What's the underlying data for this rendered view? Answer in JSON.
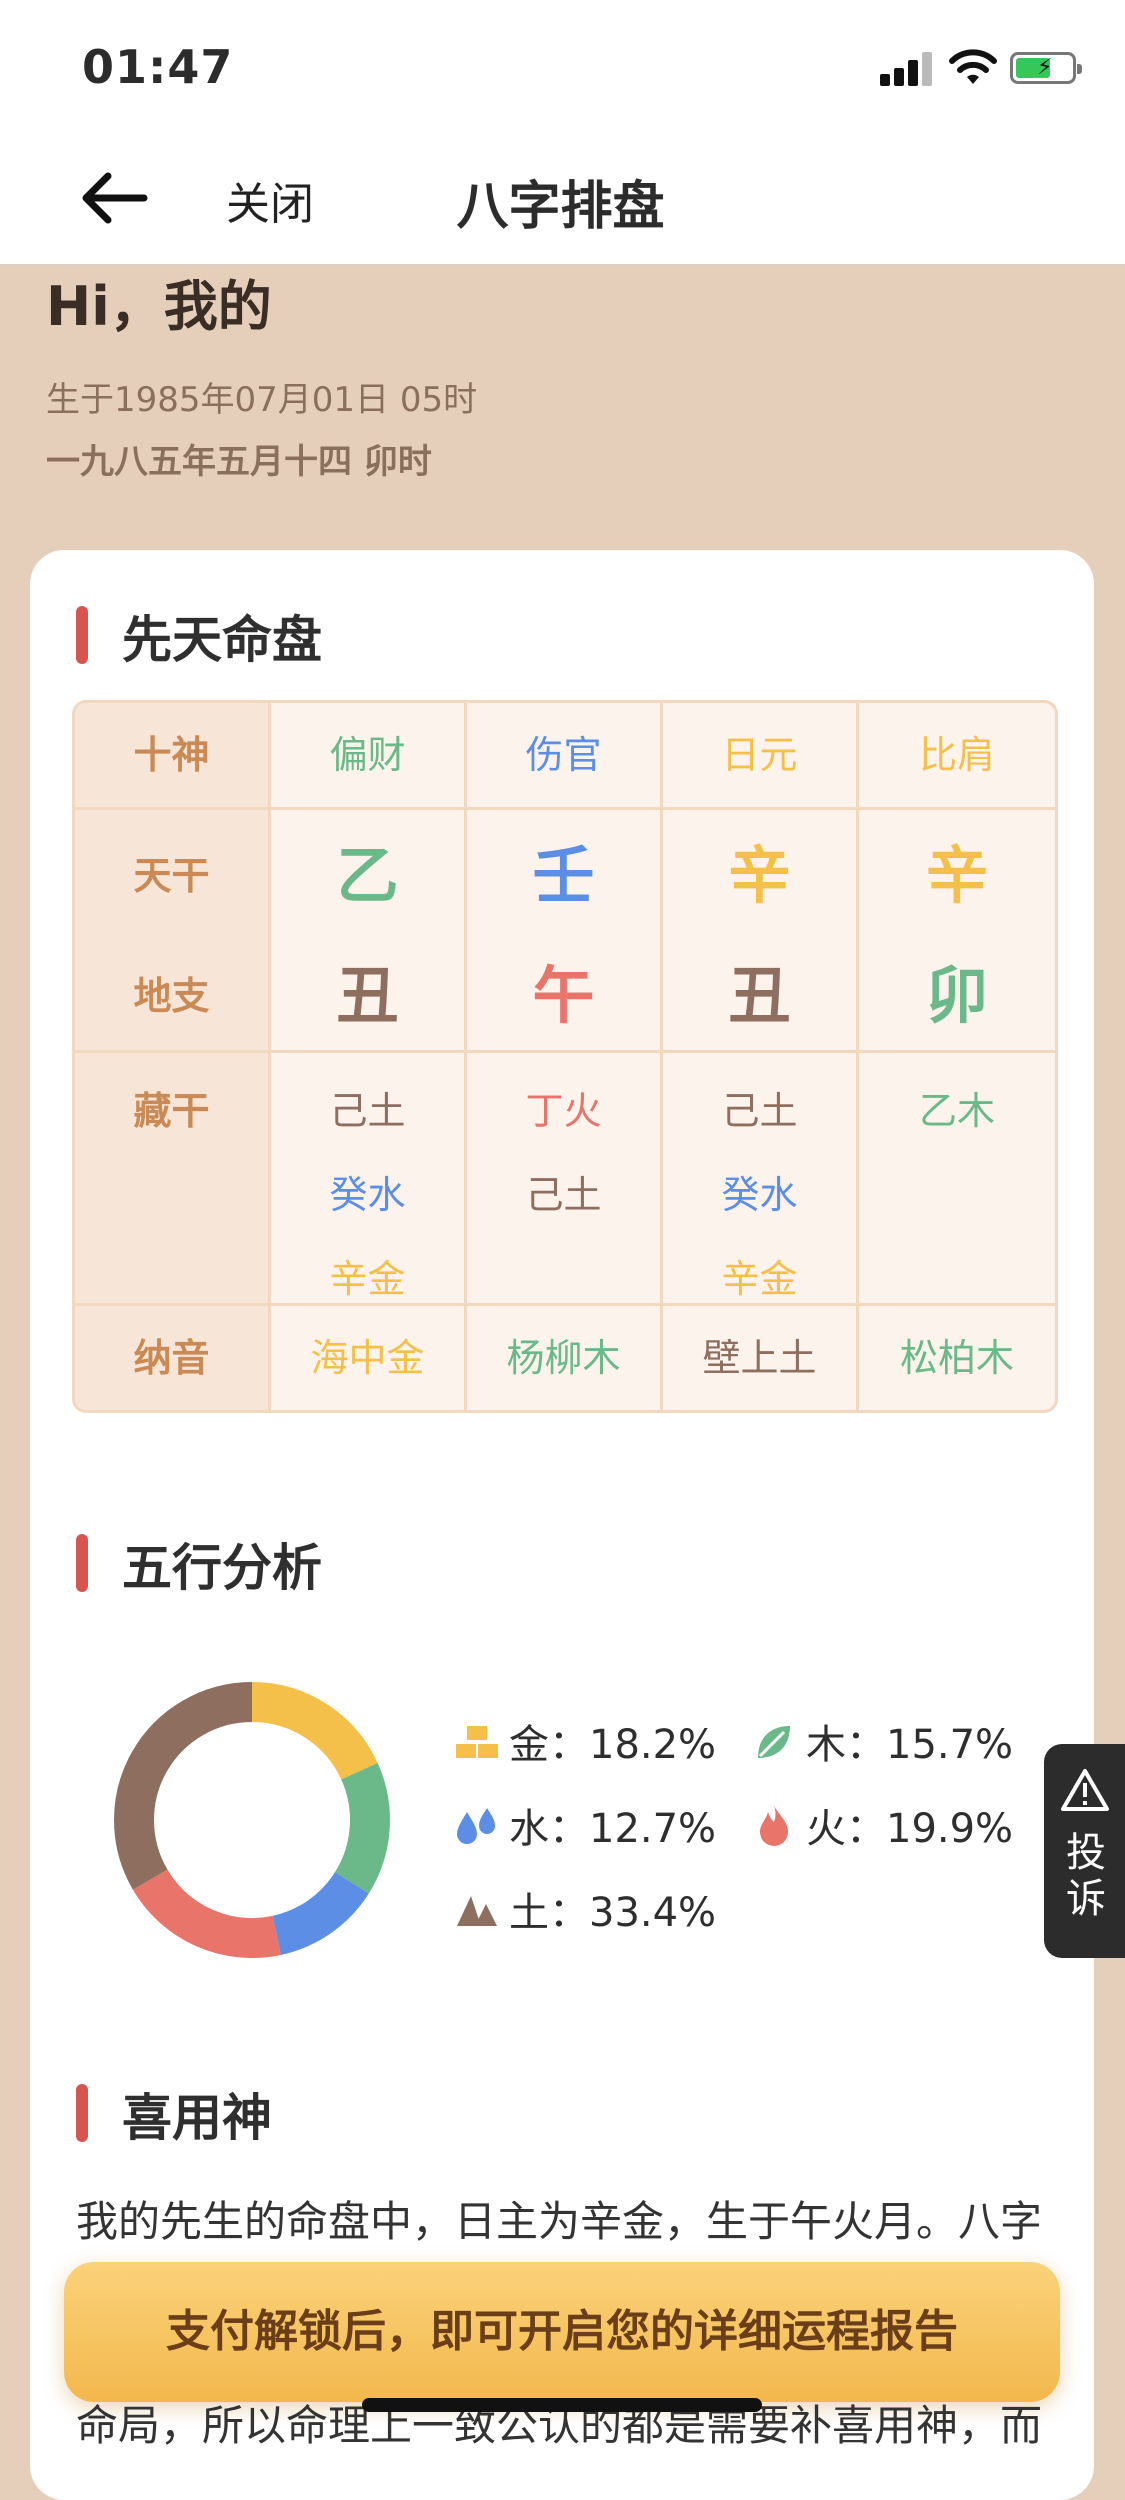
{
  "status": {
    "time": "01:47"
  },
  "nav": {
    "close": "关闭",
    "title": "八字排盘"
  },
  "profile": {
    "greeting": "Hi，我的",
    "solar": "生于1985年07月01日 05时",
    "lunar": "一九八五年五月十四 卯时"
  },
  "sections": {
    "natal": "先天命盘",
    "wuxing": "五行分析",
    "xiyong": "喜用神"
  },
  "table": {
    "row_heads": {
      "shishen": "十神",
      "tiangan": "天干",
      "dizhi": "地支",
      "canggan": "藏干",
      "nayin": "纳音"
    },
    "columns": [
      {
        "shishen": "偏财",
        "gan": "乙",
        "zhi": "丑",
        "cang": [
          "己土",
          "癸水",
          "辛金"
        ],
        "nayin": "海中金"
      },
      {
        "shishen": "伤官",
        "gan": "壬",
        "zhi": "午",
        "cang": [
          "丁火",
          "己土"
        ],
        "nayin": "杨柳木"
      },
      {
        "shishen": "日元",
        "gan": "辛",
        "zhi": "丑",
        "cang": [
          "己土",
          "癸水",
          "辛金"
        ],
        "nayin": "壁上土"
      },
      {
        "shishen": "比肩",
        "gan": "辛",
        "zhi": "卯",
        "cang": [
          "乙木"
        ],
        "nayin": "松柏木"
      }
    ]
  },
  "elements": {
    "gold": {
      "label": "金：18.2%",
      "value": 18.2,
      "color": "#f5c04a"
    },
    "wood": {
      "label": "木：15.7%",
      "value": 15.7,
      "color": "#6bb888"
    },
    "water": {
      "label": "水：12.7%",
      "value": 12.7,
      "color": "#5c8ee6"
    },
    "fire": {
      "label": "火：19.9%",
      "value": 19.9,
      "color": "#e8746a"
    },
    "earth": {
      "label": "土：33.4%",
      "value": 33.4,
      "color": "#8d6e5f"
    }
  },
  "paragraph": "我的先生的命盘中，日主为辛金，生于午火月。八字",
  "paywall": "支付解锁后，即可开启您的详细运程报告",
  "after_text": "命局，所以命理上一致公认的都是需要补喜用神，而",
  "complaint": {
    "label": "投诉"
  },
  "colors": {
    "gold": "#f5c04a",
    "wood": "#6bb888",
    "water": "#5c8ee6",
    "fire": "#e8746a",
    "earth": "#8d6e5f",
    "accent_red": "#d9534f",
    "head_text": "#c98a55"
  }
}
